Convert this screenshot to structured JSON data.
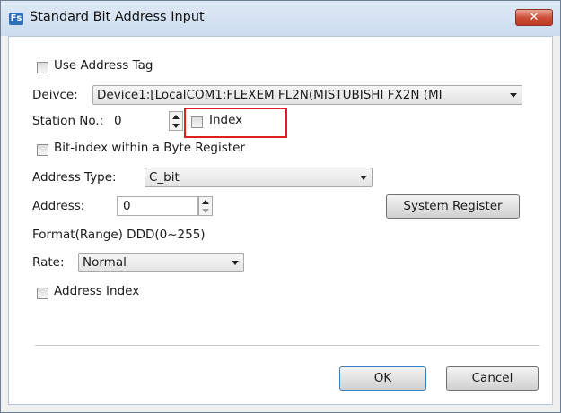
{
  "window": {
    "title": "Standard Bit Address Input",
    "app_icon_text": "Fs",
    "close_glyph": "✕"
  },
  "use_address_tag": {
    "label": "Use Address Tag",
    "checked": false
  },
  "device": {
    "label": "Deivce:",
    "value": "Device1:[LocalCOM1:FLEXEM FL2N(MISTUBISHI FX2N (MI"
  },
  "station": {
    "label": "Station No.:",
    "value": "0"
  },
  "index": {
    "label": "Index",
    "checked": false
  },
  "bit_index": {
    "label": "Bit-index within a Byte Register",
    "checked": false
  },
  "address_type": {
    "label": "Address Type:",
    "value": "C_bit"
  },
  "address": {
    "label": "Address:",
    "value": "0"
  },
  "system_register_button": "System Register",
  "format_range": "Format(Range) DDD(0~255)",
  "rate": {
    "label": "Rate:",
    "value": "Normal"
  },
  "address_index": {
    "label": "Address Index",
    "checked": false
  },
  "buttons": {
    "ok": "OK",
    "cancel": "Cancel"
  },
  "colors": {
    "highlight": "#e0201c",
    "close_button": "#c2392a",
    "titlebar": "#cbdcee"
  }
}
